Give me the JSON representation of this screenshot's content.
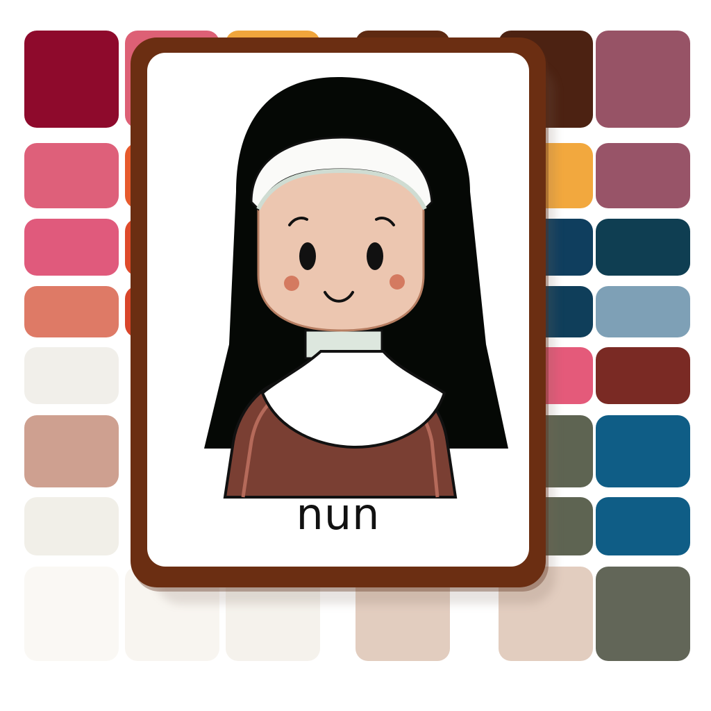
{
  "card": {
    "word": "nun",
    "border_color": "#6b2e12",
    "illustration_icon": "nun-illustration-icon"
  },
  "palette": {
    "colors": [
      "#8e0a2c",
      "#dd6075",
      "#f0a53c",
      "#5e2a12",
      "#4c2212",
      "#975366",
      "#de607a",
      "#e65a2c",
      "#f2a83e",
      "#985468",
      "#e05a7c",
      "#de4a2a",
      "#0f3e5e",
      "#0f3e52",
      "#de7a66",
      "#d8452a",
      "#0f3e5a",
      "#7ea0b6",
      "#f1efea",
      "#e45a7a",
      "#7a2a24",
      "#cea090",
      "#5e6452",
      "#0f5d86",
      "#f1efe8",
      "#5e6452",
      "#0f5d86",
      "#faf8f4",
      "#f8f5f0",
      "#f5f2ec",
      "#e2cdbf",
      "#e2cdbf",
      "#626658"
    ]
  }
}
